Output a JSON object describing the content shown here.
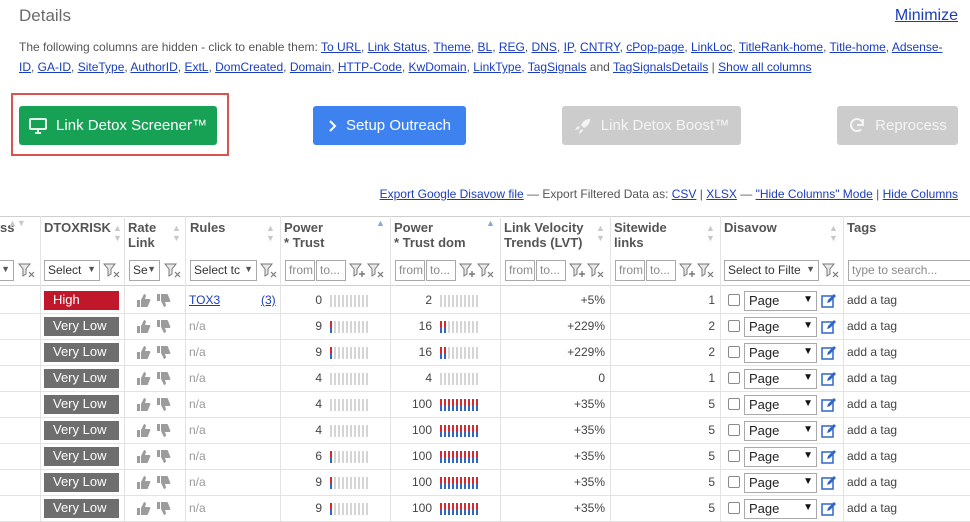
{
  "header": {
    "title": "Details",
    "minimize": "Minimize"
  },
  "hidden_columns": {
    "intro": "The following columns are hidden - click to enable them:",
    "row1": [
      "To URL",
      "Link Status",
      "Theme",
      "BL",
      "REG",
      "DNS",
      "IP",
      "CNTRY",
      "cPop-page",
      "LinkLoc",
      "TitleRank-home",
      "Title-home",
      "Adsense-"
    ],
    "row2": [
      "ID",
      "GA-ID",
      "SiteType",
      "AuthorID",
      "ExtL",
      "DomCreated",
      "Domain",
      "HTTP-Code",
      "KwDomain",
      "LinkType",
      "TagSignals"
    ],
    "and": "and",
    "last": "TagSignalsDetails",
    "show_all": "Show all columns"
  },
  "buttons": {
    "screener": "Link Detox Screener™",
    "outreach": "Setup Outreach",
    "boost": "Link Detox Boost™",
    "reprocess": "Reprocess"
  },
  "export": {
    "disavow": "Export Google Disavow file",
    "filtered": "— Export Filtered Data as:",
    "csv": "CSV",
    "xlsx": "XLSX",
    "hide_mode": "\"Hide Columns\" Mode",
    "hide_columns": "Hide Columns"
  },
  "columns": {
    "c0": "ss",
    "dtoxrisk": "DTOXRISK",
    "rate_link": [
      "Rate",
      "Link"
    ],
    "rules": "Rules",
    "power_trust": [
      "Power",
      "* Trust"
    ],
    "power_trust_dom": [
      "Power",
      "* Trust dom"
    ],
    "lvt": [
      "Link Velocity",
      "Trends (LVT)"
    ],
    "sitewide": [
      "Sitewide",
      "links"
    ],
    "disavow": "Disavow",
    "tags": "Tags"
  },
  "filters": {
    "risk_select": "Select",
    "rate_select": "Se",
    "rules_select": "Select tc",
    "from": "from",
    "to": "to...",
    "disavow_select": "Select to Filte",
    "tags_placeholder": "type to search..."
  },
  "colors": {
    "high": "#c0182a",
    "very_low": "#6e6e6e",
    "bar_red": "#d8272e",
    "bar_blue": "#2f66c8",
    "bar_empty": "#d5d5d5"
  },
  "rows": [
    {
      "risk": "High",
      "risk_level": "high",
      "rule": "TOX3",
      "rule_link": true,
      "rule_count": "(3)",
      "pt": "0",
      "ptd": "2",
      "lvt": "+5%",
      "sitewide": "1",
      "disavow": "Page",
      "tag": "add a tag"
    },
    {
      "risk": "Very Low",
      "risk_level": "very_low",
      "rule": "n/a",
      "rule_link": false,
      "rule_count": "",
      "pt": "9",
      "ptd": "16",
      "lvt": "+229%",
      "sitewide": "2",
      "disavow": "Page",
      "tag": "add a tag"
    },
    {
      "risk": "Very Low",
      "risk_level": "very_low",
      "rule": "n/a",
      "rule_link": false,
      "rule_count": "",
      "pt": "9",
      "ptd": "16",
      "lvt": "+229%",
      "sitewide": "2",
      "disavow": "Page",
      "tag": "add a tag"
    },
    {
      "risk": "Very Low",
      "risk_level": "very_low",
      "rule": "n/a",
      "rule_link": false,
      "rule_count": "",
      "pt": "4",
      "ptd": "4",
      "lvt": "0",
      "sitewide": "1",
      "disavow": "Page",
      "tag": "add a tag"
    },
    {
      "risk": "Very Low",
      "risk_level": "very_low",
      "rule": "n/a",
      "rule_link": false,
      "rule_count": "",
      "pt": "4",
      "ptd": "100",
      "lvt": "+35%",
      "sitewide": "5",
      "disavow": "Page",
      "tag": "add a tag"
    },
    {
      "risk": "Very Low",
      "risk_level": "very_low",
      "rule": "n/a",
      "rule_link": false,
      "rule_count": "",
      "pt": "4",
      "ptd": "100",
      "lvt": "+35%",
      "sitewide": "5",
      "disavow": "Page",
      "tag": "add a tag"
    },
    {
      "risk": "Very Low",
      "risk_level": "very_low",
      "rule": "n/a",
      "rule_link": false,
      "rule_count": "",
      "pt": "6",
      "ptd": "100",
      "lvt": "+35%",
      "sitewide": "5",
      "disavow": "Page",
      "tag": "add a tag"
    },
    {
      "risk": "Very Low",
      "risk_level": "very_low",
      "rule": "n/a",
      "rule_link": false,
      "rule_count": "",
      "pt": "9",
      "ptd": "100",
      "lvt": "+35%",
      "sitewide": "5",
      "disavow": "Page",
      "tag": "add a tag"
    },
    {
      "risk": "Very Low",
      "risk_level": "very_low",
      "rule": "n/a",
      "rule_link": false,
      "rule_count": "",
      "pt": "9",
      "ptd": "100",
      "lvt": "+35%",
      "sitewide": "5",
      "disavow": "Page",
      "tag": "add a tag"
    }
  ]
}
